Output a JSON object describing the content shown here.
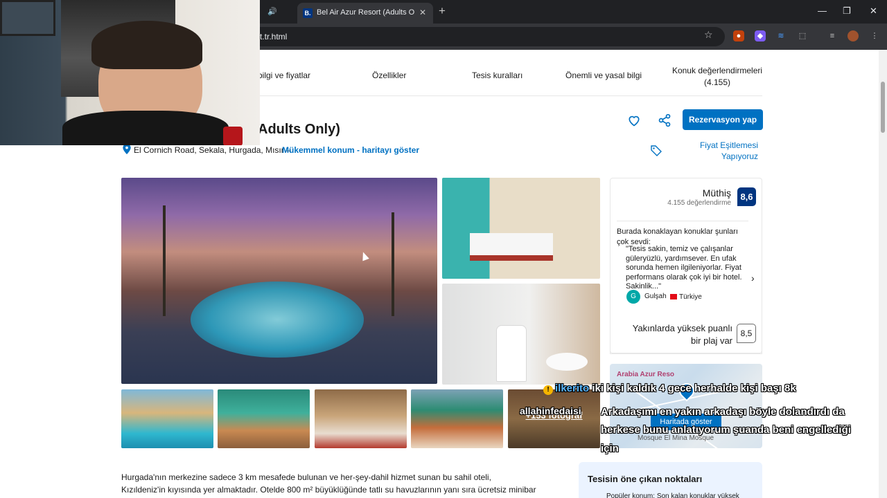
{
  "browser": {
    "tab_title": "Bel Air Azur Resort (Adults Only",
    "tab_favicon": "B.",
    "url": "t.tr.html"
  },
  "nav": {
    "tabs": [
      "bilgi ve fiyatlar",
      "Özellikler",
      "Tesis kuralları",
      "Önemli ve yasal bilgi",
      "Konuk değerlendirmeleri",
      "(4.155)"
    ]
  },
  "hotel": {
    "title_visible": "Adults Only)",
    "address": "El Cornich Road, Sekala, Hurgada, Mısır –",
    "location_link": "Mükemmel konum - haritayı göster",
    "price_match": "Fiyat Eşitlemesi Yapıyoruz",
    "reserve_label": "Rezervasyon yap",
    "more_photos": "+153 fotoğraf"
  },
  "reviews": {
    "rating_word": "Müthiş",
    "rating_count": "4.155 değerlendirme",
    "score": "8,6",
    "guests_said": "Burada konaklayan konuklar şunları çok sevdi:",
    "quote": "\"Tesis sakin, temiz ve çalışanlar güleryüzlü, yardımsever. En ufak sorunda hemen ilgileniyorlar. Fiyat performans olarak çok iyi bir hotel. Sakinlik...\"",
    "avatar_letter": "G",
    "reviewer": "Gulşah",
    "country": "Türkiye",
    "beach_text": "Yakınlarda yüksek puanlı bir plaj var",
    "beach_score": "8,5"
  },
  "map": {
    "label": "Arabia Azur Reso",
    "button": "Haritada göster",
    "street": "Mosque El Mina Mosque"
  },
  "description": "Hurgada'nın merkezine sadece 3 km mesafede bulunan ve her-şey-dahil hizmet sunan bu sahil oteli, Kızıldeniz'in kıyısında yer almaktadır. Otelde 800 m² büyüklüğünde tatlı su havuzlarının yanı sıra ücretsiz minibar ve balkon içeren",
  "highlights": {
    "title": "Tesisin öne çıkan noktaları",
    "item": "Popüler konum: Son kalan konuklar yüksek"
  },
  "chat": {
    "line1_user": "ilkerito",
    "line1_text": " iki kişi kaldık 4 gece herhalde kişi başı 8k",
    "line2": "Arkadaşımı en yakın arkadaşı böyle dolandırdı da",
    "line3": "herkese bunu anlatıyorum şuanda beni engellediği",
    "line4": "için",
    "user2": "allahinfedaisi"
  }
}
